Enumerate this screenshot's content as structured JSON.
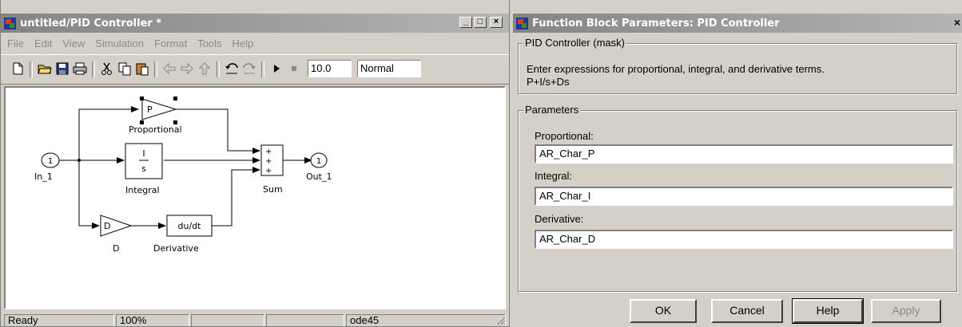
{
  "simulink": {
    "title": "untitled/PID Controller *",
    "menu": [
      "File",
      "Edit",
      "View",
      "Simulation",
      "Format",
      "Tools",
      "Help"
    ],
    "stop_time": "10.0",
    "sim_mode": "Normal",
    "blocks": {
      "in_port_num": "1",
      "in_port_label": "In_1",
      "proportional_gain": "P",
      "proportional_label": "Proportional",
      "integral_num": "I",
      "integral_den": "s",
      "integral_label": "Integral",
      "derivative_gain": "D",
      "derivative_gain_label": "D",
      "derivative_text": "du/dt",
      "derivative_label": "Derivative",
      "sum_signs": [
        "+",
        "+",
        "+"
      ],
      "sum_label": "Sum",
      "out_port_num": "1",
      "out_port_label": "Out_1"
    },
    "status": {
      "state": "Ready",
      "zoom": "100%",
      "solver": "ode45"
    }
  },
  "dialog": {
    "title": "Function Block Parameters: PID Controller",
    "mask_group_label": "PID Controller (mask)",
    "description_line1": "Enter expressions for proportional, integral, and derivative terms.",
    "description_line2": "P+I/s+Ds",
    "params_group_label": "Parameters",
    "fields": [
      {
        "label": "Proportional:",
        "value": "AR_Char_P"
      },
      {
        "label": "Integral:",
        "value": "AR_Char_I"
      },
      {
        "label": "Derivative:",
        "value": "AR_Char_D"
      }
    ],
    "buttons": {
      "ok": "OK",
      "cancel": "Cancel",
      "help": "Help",
      "apply": "Apply"
    }
  }
}
